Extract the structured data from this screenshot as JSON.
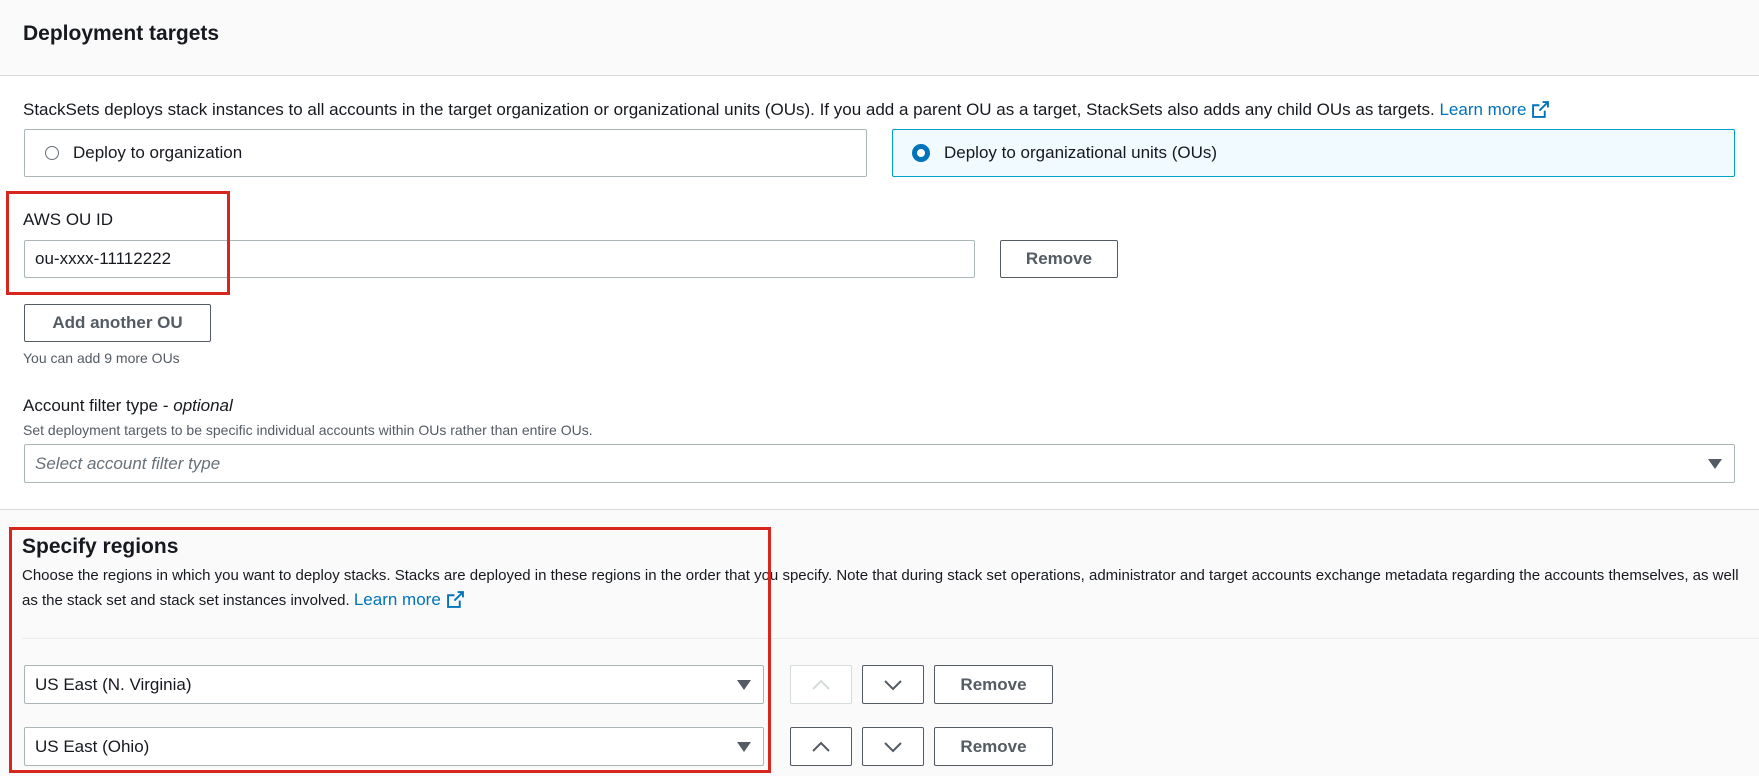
{
  "deployment_targets": {
    "title": "Deployment targets",
    "description": "StackSets deploys stack instances to all accounts in the target organization or organizational units (OUs). If you add a parent OU as a target, StackSets also adds any child OUs as targets.",
    "learn_more": "Learn more",
    "options": [
      {
        "label": "Deploy to organization",
        "selected": false
      },
      {
        "label": "Deploy to organizational units (OUs)",
        "selected": true
      }
    ],
    "ou_id_label": "AWS OU ID",
    "ou_id_value": "ou-xxxx-11112222",
    "remove_label": "Remove",
    "add_ou_label": "Add another OU",
    "add_ou_hint": "You can add 9 more OUs",
    "filter_label": "Account filter type",
    "filter_optional": "optional",
    "filter_separator": " - ",
    "filter_hint": "Set deployment targets to be specific individual accounts within OUs rather than entire OUs.",
    "filter_placeholder": "Select account filter type"
  },
  "regions": {
    "title": "Specify regions",
    "description": "Choose the regions in which you want to deploy stacks. Stacks are deployed in these regions in the order that you specify. Note that during stack set operations, administrator and target accounts exchange metadata regarding the accounts themselves, as well as the stack set and stack set instances involved.",
    "learn_more": "Learn more",
    "rows": [
      {
        "region": "US East (N. Virginia)",
        "move_up_enabled": false,
        "remove_label": "Remove"
      },
      {
        "region": "US East (Ohio)",
        "move_up_enabled": true,
        "remove_label": "Remove"
      }
    ]
  },
  "colors": {
    "link": "#0073bb",
    "highlight_box": "#d7261e",
    "selected_tile_border": "#00a1c9",
    "selected_tile_bg": "#f1faff"
  },
  "icons": {
    "external_link": "external-link-icon",
    "dropdown": "caret-down-icon",
    "move_up": "chevron-up-icon",
    "move_down": "chevron-down-icon"
  }
}
